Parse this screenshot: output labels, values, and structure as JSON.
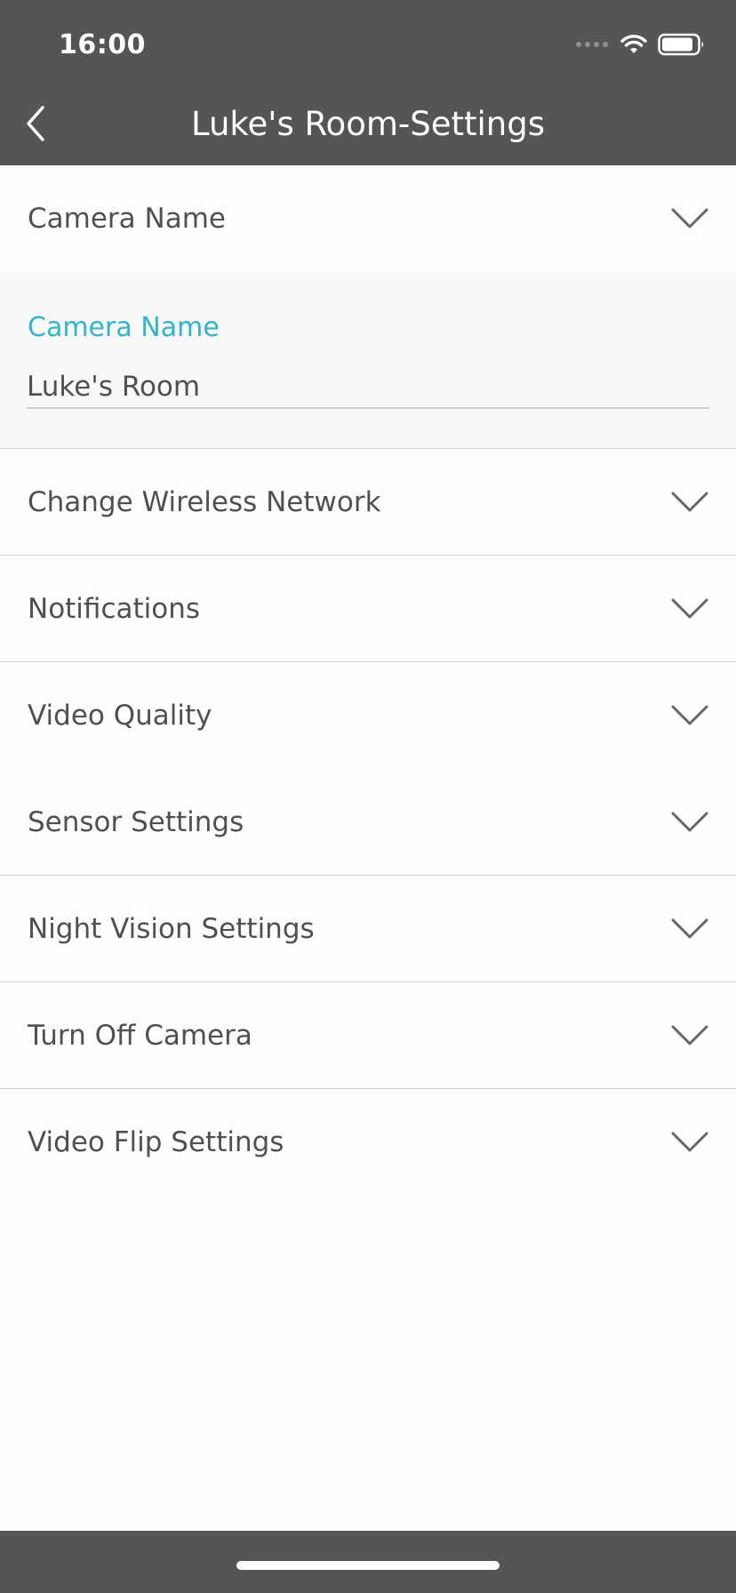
{
  "status_bar": {
    "time": "16:00",
    "icons": [
      "signal-dots-icon",
      "wifi-icon",
      "battery-icon"
    ]
  },
  "header": {
    "title": "Luke's Room-Settings",
    "back_icon": "chevron-left-icon",
    "background_color": "#555555"
  },
  "sections": {
    "camera_name": {
      "label": "Camera Name",
      "expanded": true,
      "field_label": "Camera Name",
      "field_value": "Luke's Room"
    },
    "items": [
      {
        "label": "Change Wireless Network"
      },
      {
        "label": "Notifications"
      },
      {
        "label": "Video Quality"
      },
      {
        "label": "Sensor Settings"
      },
      {
        "label": "Night Vision Settings"
      },
      {
        "label": "Turn Off Camera"
      },
      {
        "label": "Video Flip Settings"
      }
    ]
  },
  "colors": {
    "accent": "#2eb6cf",
    "text": "#505050",
    "divider": "#d2d2d2"
  }
}
